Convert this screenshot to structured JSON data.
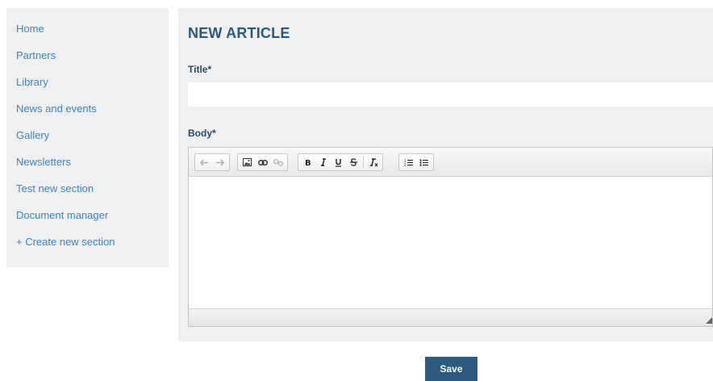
{
  "sidebar": {
    "items": [
      {
        "label": "Home"
      },
      {
        "label": "Partners"
      },
      {
        "label": "Library"
      },
      {
        "label": "News and events"
      },
      {
        "label": "Gallery"
      },
      {
        "label": "Newsletters"
      },
      {
        "label": "Test new section"
      },
      {
        "label": "Document manager"
      },
      {
        "label": "+ Create new section"
      }
    ]
  },
  "form": {
    "heading": "NEW ARTICLE",
    "title_label": "Title*",
    "title_value": "",
    "body_label": "Body*",
    "save_label": "Save"
  },
  "editor": {
    "toolbar_groups": [
      [
        "undo-icon",
        "redo-icon"
      ],
      [
        "image-icon",
        "link-icon",
        "unlink-icon"
      ],
      [
        "bold-icon",
        "italic-icon",
        "underline-icon",
        "strikethrough-icon",
        "remove-format-icon"
      ],
      [
        "numbered-list-icon",
        "bulleted-list-icon"
      ]
    ]
  },
  "colors": {
    "link": "#3d85c6",
    "heading": "#2b5a7e",
    "panel_bg": "#eef0f2",
    "save_bg": "#2d5b80"
  }
}
